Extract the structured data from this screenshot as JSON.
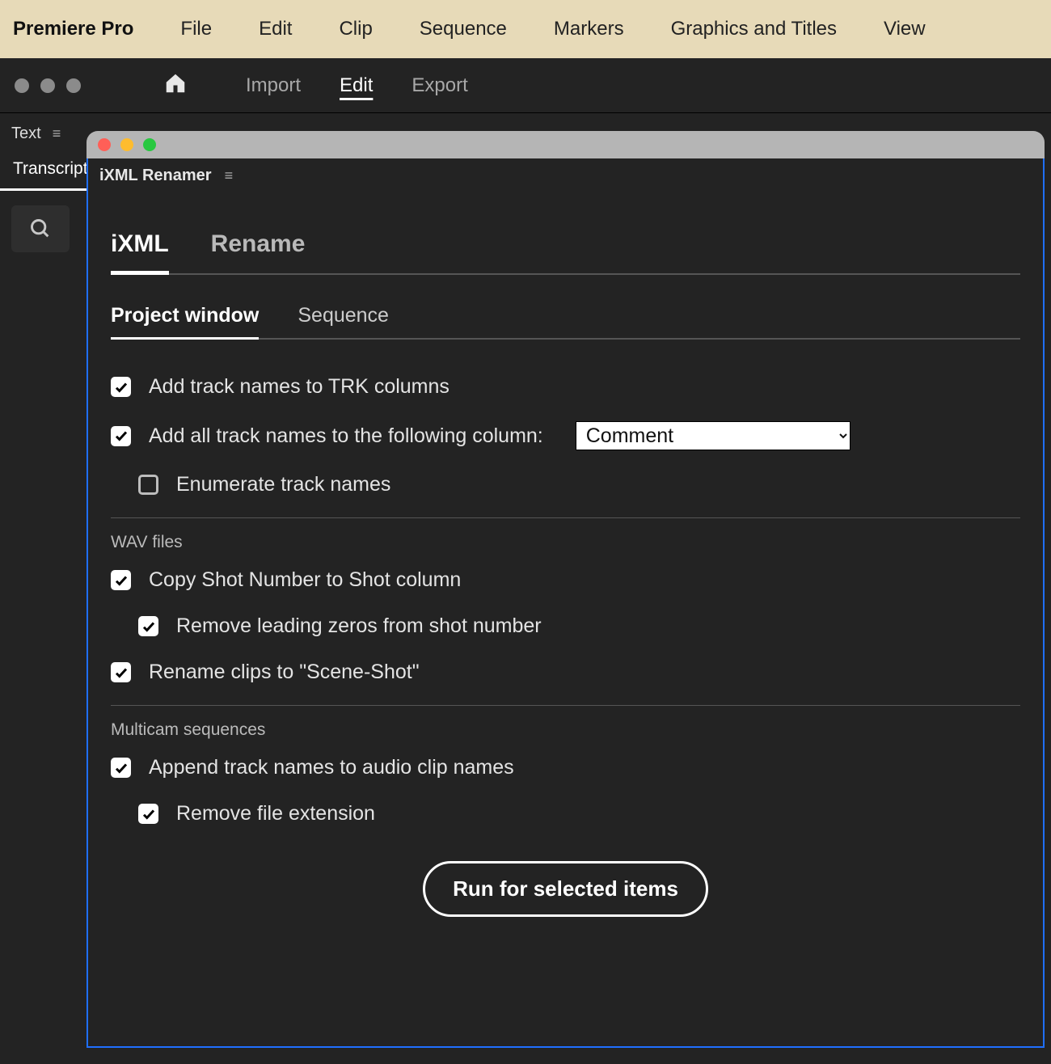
{
  "menubar": {
    "app": "Premiere Pro",
    "items": [
      "File",
      "Edit",
      "Clip",
      "Sequence",
      "Markers",
      "Graphics and Titles",
      "View"
    ]
  },
  "appChrome": {
    "tabs": {
      "import": "Import",
      "edit": "Edit",
      "export": "Export"
    }
  },
  "leftPanel": {
    "title": "Text",
    "subtab": "Transcript"
  },
  "dialog": {
    "title": "iXML Renamer",
    "primaryTabs": {
      "ixml": "iXML",
      "rename": "Rename"
    },
    "secondaryTabs": {
      "project": "Project window",
      "sequence": "Sequence"
    },
    "options": {
      "addTrk": "Add track names to TRK columns",
      "addAll": "Add all track names to the following column:",
      "enumerate": "Enumerate track names",
      "columnSelect": "Comment",
      "wavTitle": "WAV files",
      "copyShot": "Copy Shot Number to Shot column",
      "removeZeros": "Remove leading zeros from shot number",
      "renameClips": "Rename clips to \"Scene-Shot\"",
      "multicamTitle": "Multicam sequences",
      "appendTrack": "Append track names to audio clip names",
      "removeExt": "Remove file extension"
    },
    "runButton": "Run for selected items"
  }
}
